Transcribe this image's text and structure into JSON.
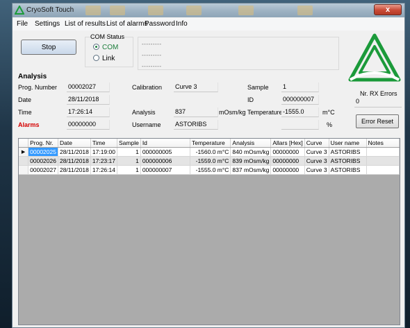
{
  "window": {
    "title": "CryoSoft Touch",
    "close_label": "x"
  },
  "menu": [
    "File",
    "Settings",
    "List of results",
    "List of alarms",
    "Password",
    "Info"
  ],
  "controls": {
    "stop_label": "Stop",
    "com_status_label": "COM Status",
    "radio_com": "COM",
    "radio_link": "Link",
    "selected_radio": "COM",
    "status_lines": [
      "---------",
      "---------",
      "---------"
    ]
  },
  "analysis": {
    "title": "Analysis",
    "prog_number_label": "Prog. Number",
    "prog_number": "00002027",
    "date_label": "Date",
    "date": "28/11/2018",
    "time_label": "Time",
    "time": "17:26:14",
    "alarms_label": "Alarms",
    "alarms": "00000000",
    "calibration_label": "Calibration",
    "calibration": "Curve 3",
    "analysis_label": "Analysis",
    "analysis_value": "837",
    "analysis_unit": "mOsm/kg",
    "username_label": "Username",
    "username": "ASTORIBS",
    "sample_label": "Sample",
    "sample": "1",
    "id_label": "ID",
    "id": "000000007",
    "temperature_label": "Temperature",
    "temperature": "-1555.0",
    "temperature_unit": "m°C",
    "percent_unit": "%"
  },
  "side": {
    "rx_errors_label": "Nr. RX Errors",
    "rx_errors": "0",
    "error_reset_label": "Error Reset"
  },
  "table": {
    "columns": [
      "Prog. Nr.",
      "Date",
      "Time",
      "Sample",
      "Id",
      "Temperature",
      "Analysis",
      "Allars [Hex]",
      "Curve",
      "User name",
      "Notes"
    ],
    "rows": [
      [
        "00002025",
        "28/11/2018",
        "17:19:00",
        "1",
        "000000005",
        "-1560.0 m°C",
        "840 mOsm/kg",
        "00000000",
        "Curve 3",
        "ASTORIBS",
        ""
      ],
      [
        "00002026",
        "28/11/2018",
        "17:23:17",
        "1",
        "000000006",
        "-1559.0 m°C",
        "839 mOsm/kg",
        "00000000",
        "Curve 3",
        "ASTORIBS",
        ""
      ],
      [
        "00002027",
        "28/11/2018",
        "17:26:14",
        "1",
        "000000007",
        "-1555.0 m°C",
        "837 mOsm/kg",
        "00000000",
        "Curve 3",
        "ASTORIBS",
        ""
      ]
    ],
    "current_row_marker": "▶"
  },
  "colors": {
    "accent_green": "#1b7d3a",
    "alarm_red": "#d40000",
    "selection_blue": "#3399ff"
  }
}
